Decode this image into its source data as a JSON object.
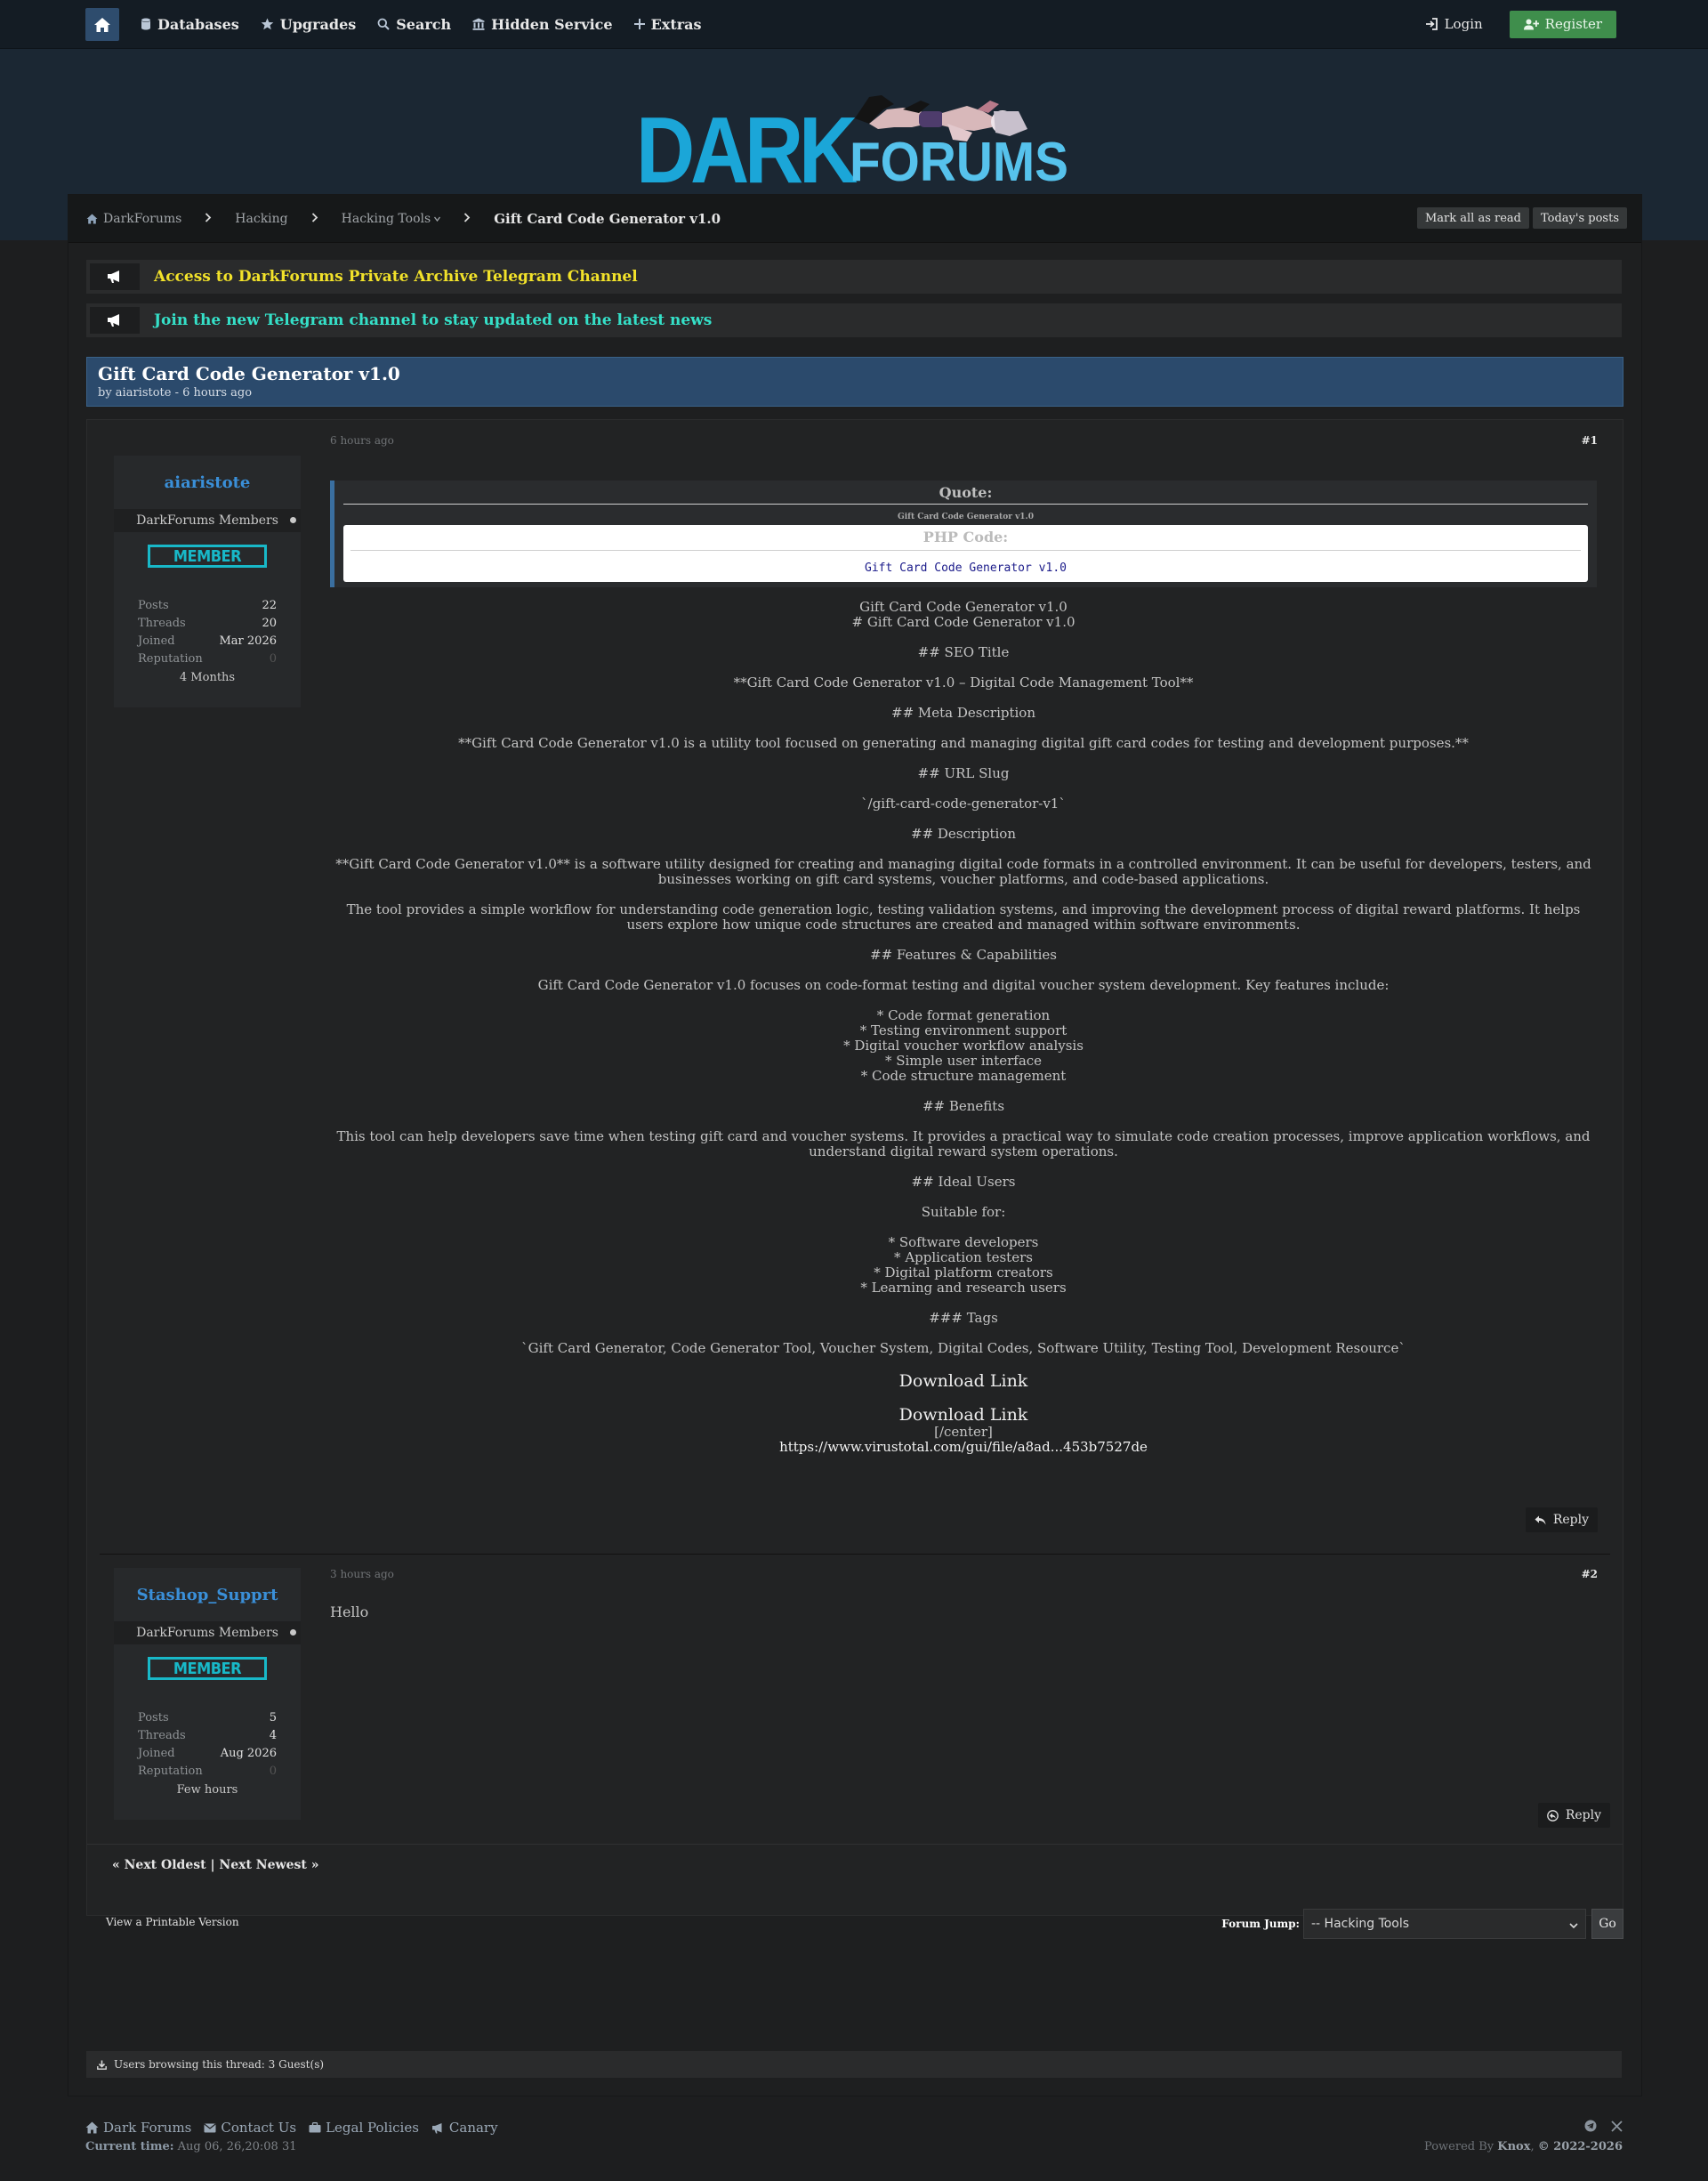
{
  "nav": {
    "items": [
      {
        "label": "Databases",
        "icon": "database-icon"
      },
      {
        "label": "Upgrades",
        "icon": "star-icon"
      },
      {
        "label": "Search",
        "icon": "search-icon"
      },
      {
        "label": "Hidden Service",
        "icon": "building-icon"
      },
      {
        "label": "Extras",
        "icon": "plus-icon"
      }
    ],
    "login": "Login",
    "register": "Register"
  },
  "logo": {
    "word1": "DARK",
    "word2": "FORUMS",
    "colors": {
      "primary": "#1ba6d8",
      "secondary": "#56c2ec"
    }
  },
  "breadcrumb": {
    "items": [
      "DarkForums",
      "Hacking",
      "Hacking Tools"
    ],
    "current": "Gift Card Code Generator v1.0",
    "mark_read": "Mark all as read",
    "todays_posts": "Today's posts"
  },
  "announcements": [
    {
      "text": "Access to DarkForums Private Archive Telegram Channel",
      "color": "#f2e22a"
    },
    {
      "text": "Join the new Telegram channel to stay updated on the latest news",
      "color": "#35e0c8"
    }
  ],
  "thread": {
    "title": "Gift Card Code Generator v1.0",
    "byline": "by aiaristote - 6 hours ago"
  },
  "posts": [
    {
      "author": {
        "name": "aiaristote",
        "group": "DarkForums Members",
        "rank": "MEMBER",
        "stats": [
          {
            "label": "Posts",
            "value": "22"
          },
          {
            "label": "Threads",
            "value": "20"
          },
          {
            "label": "Joined",
            "value": "Mar 2026"
          },
          {
            "label": "Reputation",
            "value": "0"
          }
        ],
        "footer": "4 Months"
      },
      "time": "6 hours ago",
      "number": "#1",
      "quote": {
        "header": "Quote:",
        "small": "Gift Card Code Generator v1.0",
        "code_header": "PHP Code:",
        "code": "Gift Card Code Generator v1.0"
      },
      "paragraphs": [
        [
          "Gift Card Code Generator v1.0",
          "# Gift Card Code Generator v1.0"
        ],
        [
          "## SEO Title"
        ],
        [
          "**Gift Card Code Generator v1.0 – Digital Code Management Tool**"
        ],
        [
          "## Meta Description"
        ],
        [
          "**Gift Card Code Generator v1.0 is a utility tool focused on generating and managing digital gift card codes for testing and development purposes.**"
        ],
        [
          "## URL Slug"
        ],
        [
          "`/gift-card-code-generator-v1`"
        ],
        [
          "## Description"
        ],
        [
          "**Gift Card Code Generator v1.0** is a software utility designed for creating and managing digital code formats in a controlled environment. It can be useful for developers, testers, and businesses working on gift card systems, voucher platforms, and code-based applications."
        ],
        [
          "The tool provides a simple workflow for understanding code generation logic, testing validation systems, and improving the development process of digital reward platforms. It helps users explore how unique code structures are created and managed within software environments."
        ],
        [
          "## Features & Capabilities"
        ],
        [
          "Gift Card Code Generator v1.0 focuses on code-format testing and digital voucher system development. Key features include:"
        ],
        [
          "* Code format generation",
          "* Testing environment support",
          "* Digital voucher workflow analysis",
          "* Simple user interface",
          "* Code structure management"
        ],
        [
          "## Benefits"
        ],
        [
          "This tool can help developers save time when testing gift card and voucher systems. It provides a practical way to simulate code creation processes, improve application workflows, and understand digital reward system operations."
        ],
        [
          "## Ideal Users"
        ],
        [
          "Suitable for:"
        ],
        [
          "* Software developers",
          "* Application testers",
          "* Digital platform creators",
          "* Learning and research users"
        ],
        [
          "### Tags"
        ],
        [
          "`Gift Card Generator, Code Generator Tool, Voucher System, Digital Codes, Software Utility, Testing Tool, Development Resource`"
        ]
      ],
      "download_links": [
        "Download Link",
        "Download Link"
      ],
      "center_tag": "[/center]",
      "virustotal": "https://www.virustotal.com/gui/file/a8ad...453b7527de",
      "reply": "Reply"
    },
    {
      "author": {
        "name": "Stashop_Supprt",
        "group": "DarkForums Members",
        "rank": "MEMBER",
        "stats": [
          {
            "label": "Posts",
            "value": "5"
          },
          {
            "label": "Threads",
            "value": "4"
          },
          {
            "label": "Joined",
            "value": "Aug 2026"
          },
          {
            "label": "Reputation",
            "value": "0"
          }
        ],
        "footer": "Few hours"
      },
      "time": "3 hours ago",
      "number": "#2",
      "message": "Hello",
      "reply": "Reply"
    }
  ],
  "pager": "« Next Oldest | Next Newest »",
  "printable": "View a Printable Version",
  "forum_jump": {
    "label": "Forum Jump:",
    "selected": "-- Hacking Tools",
    "go": "Go"
  },
  "browsing": "Users browsing this thread: 3 Guest(s)",
  "footer": {
    "links": [
      "Dark Forums",
      "Contact Us",
      "Legal Policies",
      "Canary"
    ],
    "current_time_label": "Current time:",
    "current_time": "Aug 06, 26,20:08 31",
    "powered_prefix": "Powered By",
    "powered_name": "Knox",
    "copyright": "© 2022-2026"
  }
}
